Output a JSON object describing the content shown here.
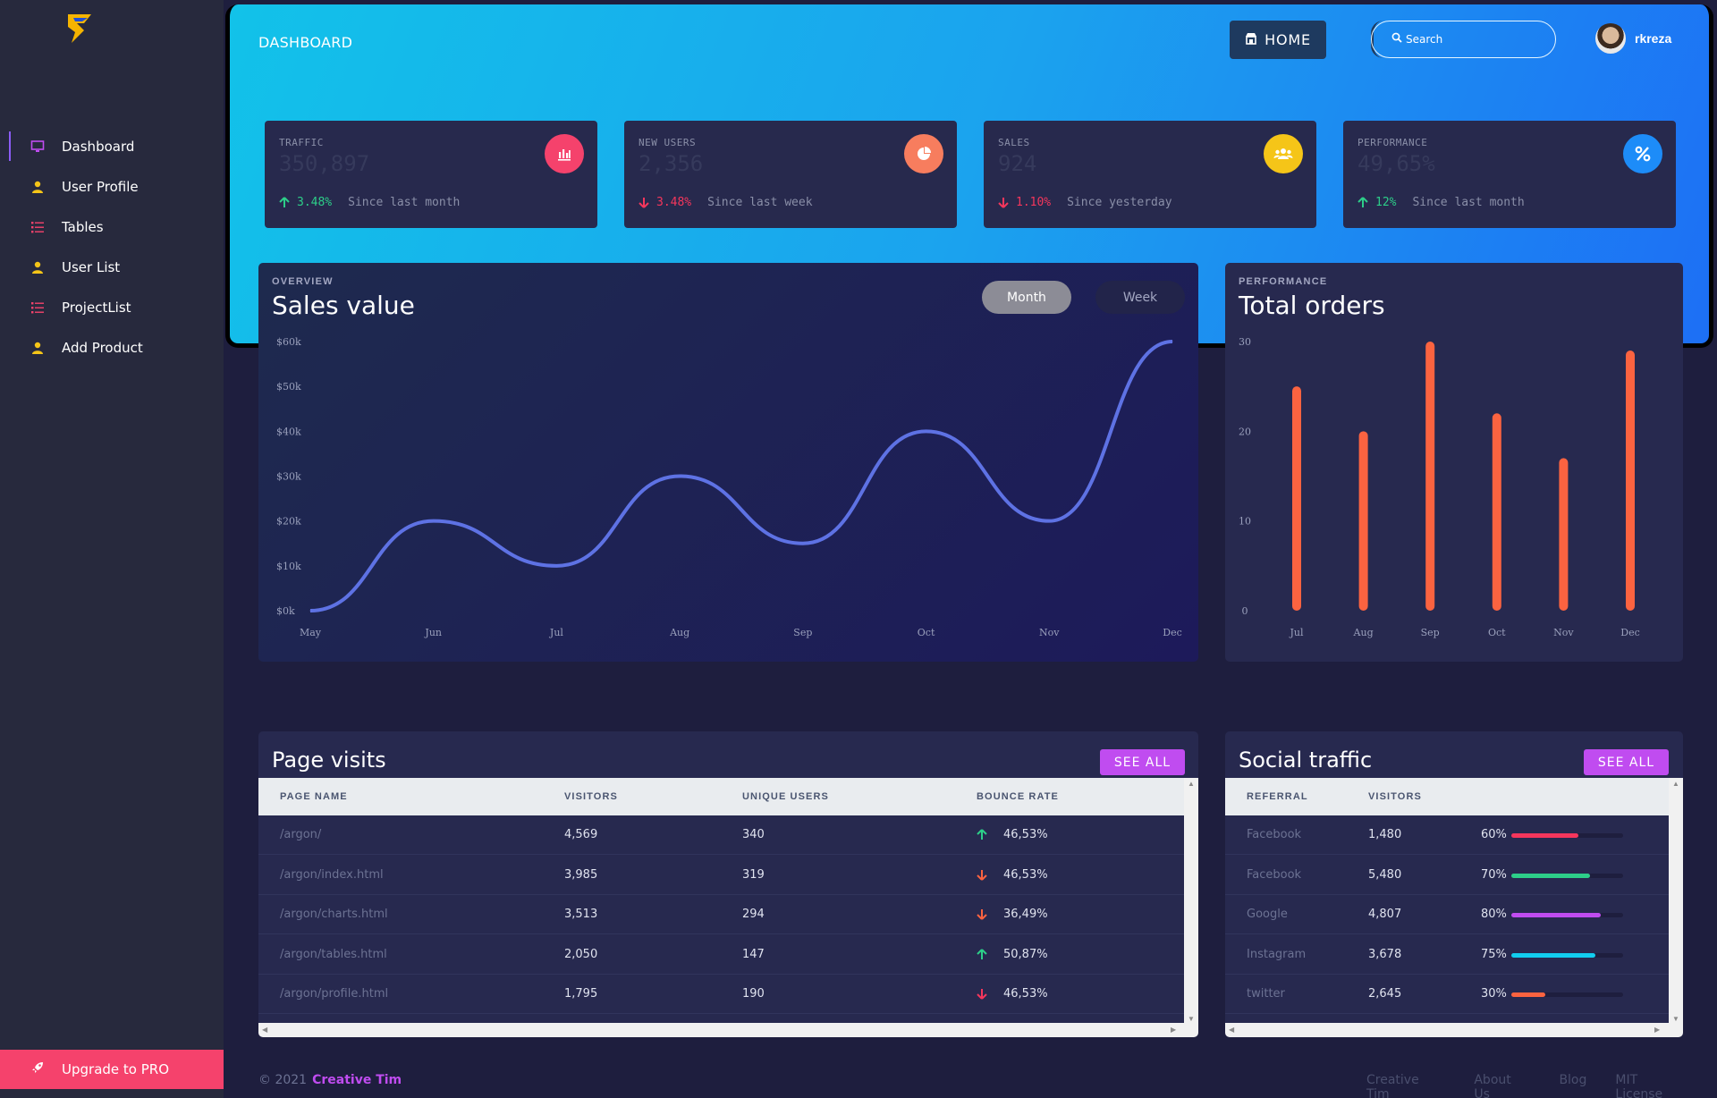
{
  "sidebar": {
    "items": [
      {
        "label": "Dashboard",
        "icon": "desktop-icon",
        "color": "#c04cf0"
      },
      {
        "label": "User Profile",
        "icon": "person-icon",
        "color": "#f5c518"
      },
      {
        "label": "Tables",
        "icon": "list-icon",
        "color": "#f5426c"
      },
      {
        "label": "User List",
        "icon": "person-icon",
        "color": "#f5c518"
      },
      {
        "label": "ProjectList",
        "icon": "list-icon",
        "color": "#f5426c"
      },
      {
        "label": "Add Product",
        "icon": "person-icon",
        "color": "#f5c518"
      }
    ],
    "upgrade_label": "Upgrade to PRO"
  },
  "header": {
    "title": "DASHBOARD",
    "home_label": "HOME",
    "search_placeholder": "Search",
    "username": "rkreza"
  },
  "stats": [
    {
      "label": "TRAFFIC",
      "value": "350,897",
      "change": "3.48%",
      "direction": "up",
      "since": "Since last month",
      "icon": "bar-chart-icon",
      "icon_bg": "#f5426c"
    },
    {
      "label": "NEW USERS",
      "value": "2,356",
      "change": "3.48%",
      "direction": "down",
      "since": "Since last week",
      "icon": "pie-chart-icon",
      "icon_bg": "#f77d5e"
    },
    {
      "label": "SALES",
      "value": "924",
      "change": "1.10%",
      "direction": "down",
      "since": "Since yesterday",
      "icon": "users-icon",
      "icon_bg": "#f5c518"
    },
    {
      "label": "PERFORMANCE",
      "value": "49,65%",
      "change": "12%",
      "direction": "up",
      "since": "Since last month",
      "icon": "percent-icon",
      "icon_bg": "#1d8cf8"
    }
  ],
  "sales": {
    "overline": "OVERVIEW",
    "title": "Sales value",
    "toggle_month": "Month",
    "toggle_week": "Week"
  },
  "orders": {
    "overline": "PERFORMANCE",
    "title": "Total orders"
  },
  "chart_data": [
    {
      "type": "line",
      "title": "Sales value",
      "categories": [
        "May",
        "Jun",
        "Jul",
        "Aug",
        "Sep",
        "Oct",
        "Nov",
        "Dec"
      ],
      "series": [
        {
          "values": [
            0,
            20,
            10,
            30,
            15,
            40,
            20,
            60
          ]
        }
      ],
      "y_ticks": [
        "$0k",
        "$10k",
        "$20k",
        "$30k",
        "$40k",
        "$50k",
        "$60k"
      ],
      "ylim": [
        0,
        60
      ],
      "color": "#5e72e4"
    },
    {
      "type": "bar",
      "title": "Total orders",
      "categories": [
        "Jul",
        "Aug",
        "Sep",
        "Oct",
        "Nov",
        "Dec"
      ],
      "values": [
        25,
        20,
        30,
        22,
        17,
        29
      ],
      "y_ticks": [
        "0",
        "10",
        "20",
        "30"
      ],
      "ylim": [
        0,
        30
      ],
      "color": "#fb6340"
    }
  ],
  "page_visits": {
    "title": "Page visits",
    "see_all": "SEE ALL",
    "columns": [
      "PAGE NAME",
      "VISITORS",
      "UNIQUE USERS",
      "BOUNCE RATE"
    ],
    "rows": [
      {
        "page": "/argon/",
        "visitors": "4,569",
        "unique": "340",
        "bounce": "46,53%",
        "direction": "up"
      },
      {
        "page": "/argon/index.html",
        "visitors": "3,985",
        "unique": "319",
        "bounce": "46,53%",
        "direction": "down"
      },
      {
        "page": "/argon/charts.html",
        "visitors": "3,513",
        "unique": "294",
        "bounce": "36,49%",
        "direction": "down"
      },
      {
        "page": "/argon/tables.html",
        "visitors": "2,050",
        "unique": "147",
        "bounce": "50,87%",
        "direction": "up"
      },
      {
        "page": "/argon/profile.html",
        "visitors": "1,795",
        "unique": "190",
        "bounce": "46,53%",
        "direction": "down-pink"
      }
    ]
  },
  "social_traffic": {
    "title": "Social traffic",
    "see_all": "SEE ALL",
    "columns": [
      "REFERRAL",
      "VISITORS"
    ],
    "rows": [
      {
        "referral": "Facebook",
        "visitors": "1,480",
        "percent": "60%",
        "progress": 0.6,
        "color": "#f5365c"
      },
      {
        "referral": "Facebook",
        "visitors": "5,480",
        "percent": "70%",
        "progress": 0.7,
        "color": "#2dce89"
      },
      {
        "referral": "Google",
        "visitors": "4,807",
        "percent": "80%",
        "progress": 0.8,
        "color": "#c04cf0"
      },
      {
        "referral": "Instagram",
        "visitors": "3,678",
        "percent": "75%",
        "progress": 0.75,
        "color": "#11cdef"
      },
      {
        "referral": "twitter",
        "visitors": "2,645",
        "percent": "30%",
        "progress": 0.3,
        "color": "#fb6340"
      }
    ]
  },
  "footer": {
    "copyright": "© 2021",
    "brand": "Creative Tim",
    "links": [
      "Creative Tim",
      "About Us",
      "Blog",
      "MIT License"
    ]
  }
}
